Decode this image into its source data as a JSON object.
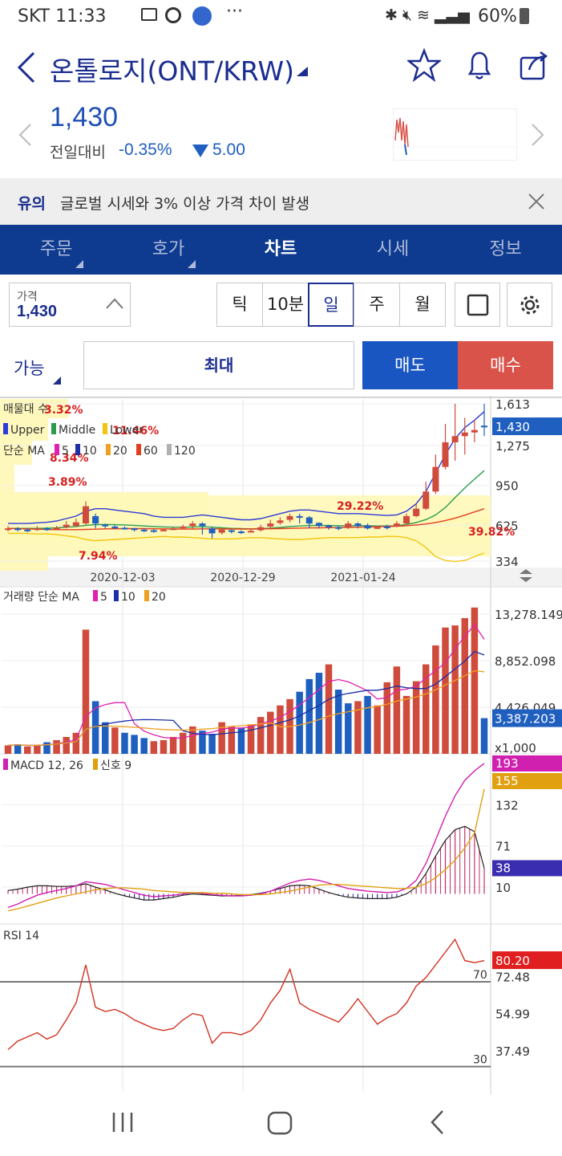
{
  "status": {
    "carrier_time": "SKT 11:33",
    "battery": "60%"
  },
  "header": {
    "title": "온톨로지(ONT/KRW)"
  },
  "quote": {
    "price": "1,430",
    "compare_label": "전일대비",
    "change_pct": "-0.35%",
    "change_abs": "5.00"
  },
  "notice": {
    "label": "유의",
    "text": "글로벌 시세와 3% 이상 가격 차이 발생"
  },
  "tabs": [
    {
      "label": "주문"
    },
    {
      "label": "호가"
    },
    {
      "label": "차트"
    },
    {
      "label": "시세"
    },
    {
      "label": "정보"
    }
  ],
  "controls": {
    "price_label": "가격",
    "price_value": "1,430",
    "intervals": [
      {
        "label": "틱"
      },
      {
        "label": "10분"
      },
      {
        "label": "일"
      },
      {
        "label": "주"
      },
      {
        "label": "월"
      }
    ]
  },
  "order": {
    "avail_label": "가능",
    "max_label": "최대",
    "sell_label": "매도",
    "buy_label": "매수"
  },
  "colors": {
    "brand": "#0e3b8f",
    "sell": "#1a56c2",
    "buy": "#d9534a",
    "up": "#cf4b3c",
    "down": "#1f5fbf"
  },
  "chart_data": [
    {
      "type": "candlestick",
      "legend": {
        "volume_profile": "매물대 수",
        "bollinger": [
          "Upper",
          "Middle",
          "Lower"
        ],
        "ma_label": "단순 MA",
        "ma_periods": [
          "5",
          "10",
          "20",
          "60",
          "120"
        ]
      },
      "price_ticks": [
        "1,613",
        "1,275",
        "950",
        "625",
        "334"
      ],
      "current_price": "1,430",
      "dates": [
        "2020-12-03",
        "2020-12-29",
        "2021-01-24"
      ],
      "profile_labels": [
        "3.32%",
        "11.46%",
        "3.89%",
        "7.94%",
        "29.22%",
        "39.82%"
      ],
      "profile_hidden": "8.34%",
      "close": [
        600,
        590,
        585,
        600,
        595,
        605,
        630,
        650,
        780,
        640,
        620,
        610,
        600,
        590,
        585,
        580,
        590,
        600,
        615,
        640,
        620,
        560,
        590,
        575,
        570,
        580,
        610,
        640,
        665,
        700,
        690,
        640,
        620,
        610,
        600,
        640,
        620,
        600,
        610,
        605,
        640,
        700,
        760,
        900,
        1100,
        1300,
        1350,
        1380,
        1400,
        1430
      ],
      "open": [
        590,
        600,
        590,
        590,
        600,
        600,
        610,
        620,
        640,
        700,
        630,
        615,
        605,
        600,
        590,
        585,
        585,
        595,
        605,
        620,
        640,
        600,
        565,
        585,
        575,
        575,
        585,
        615,
        645,
        670,
        700,
        690,
        645,
        625,
        610,
        605,
        640,
        625,
        605,
        615,
        615,
        640,
        700,
        760,
        900,
        1100,
        1300,
        1350,
        1380,
        1435
      ],
      "high": [
        620,
        610,
        600,
        620,
        610,
        620,
        660,
        680,
        820,
        720,
        640,
        625,
        615,
        605,
        600,
        595,
        600,
        615,
        630,
        660,
        650,
        615,
        600,
        590,
        585,
        600,
        630,
        670,
        690,
        720,
        720,
        700,
        650,
        630,
        620,
        660,
        650,
        640,
        620,
        630,
        660,
        720,
        800,
        980,
        1200,
        1450,
        1613,
        1500,
        1480,
        1613
      ],
      "low": [
        575,
        575,
        570,
        580,
        580,
        585,
        600,
        610,
        630,
        600,
        600,
        595,
        590,
        575,
        570,
        565,
        575,
        585,
        595,
        600,
        550,
        520,
        550,
        560,
        555,
        565,
        575,
        600,
        630,
        650,
        640,
        600,
        600,
        590,
        585,
        595,
        600,
        590,
        595,
        590,
        610,
        630,
        690,
        750,
        880,
        1080,
        1150,
        1200,
        1300,
        1350
      ],
      "ma_upper": [
        640,
        640,
        640,
        645,
        650,
        660,
        680,
        700,
        740,
        760,
        760,
        750,
        740,
        730,
        720,
        700,
        690,
        690,
        690,
        700,
        710,
        700,
        690,
        680,
        670,
        670,
        680,
        700,
        720,
        740,
        750,
        750,
        740,
        730,
        720,
        720,
        720,
        715,
        710,
        705,
        710,
        740,
        800,
        900,
        1050,
        1200,
        1330,
        1420,
        1480,
        1550
      ],
      "ma_middle": [
        600,
        600,
        600,
        600,
        602,
        605,
        610,
        615,
        625,
        630,
        632,
        630,
        628,
        625,
        620,
        615,
        612,
        610,
        610,
        612,
        614,
        610,
        605,
        600,
        598,
        596,
        598,
        602,
        608,
        615,
        620,
        624,
        625,
        624,
        622,
        622,
        623,
        622,
        620,
        620,
        622,
        632,
        648,
        672,
        710,
        770,
        850,
        930,
        1000,
        1070
      ],
      "ma_lower": [
        560,
        560,
        560,
        555,
        555,
        550,
        540,
        530,
        510,
        500,
        505,
        510,
        515,
        520,
        525,
        530,
        535,
        530,
        530,
        525,
        520,
        515,
        515,
        515,
        520,
        525,
        525,
        520,
        515,
        510,
        510,
        515,
        520,
        525,
        525,
        525,
        525,
        530,
        530,
        535,
        535,
        525,
        500,
        445,
        370,
        340,
        330,
        340,
        370,
        400
      ],
      "ma60": [
        600,
        598,
        596,
        594,
        592,
        590,
        590,
        590,
        592,
        594,
        596,
        597,
        598,
        598,
        598,
        597,
        596,
        595,
        595,
        595,
        596,
        596,
        596,
        595,
        595,
        595,
        596,
        597,
        598,
        600,
        602,
        604,
        605,
        606,
        607,
        608,
        610,
        612,
        614,
        616,
        618,
        622,
        628,
        636,
        648,
        664,
        684,
        708,
        734,
        760
      ],
      "price_axis": [
        334,
        1613
      ]
    },
    {
      "type": "bar",
      "legend": {
        "label": "거래량 단순 MA",
        "periods": [
          "5",
          "10",
          "20"
        ]
      },
      "ticks": [
        "13,278.149",
        "8,852.098",
        "4,426.049"
      ],
      "current": "3,387.203",
      "unit": "x1,000",
      "values": [
        800,
        900,
        700,
        800,
        1100,
        1300,
        1600,
        2000,
        11800,
        5000,
        3000,
        2500,
        2000,
        1800,
        1500,
        1200,
        1300,
        1600,
        2000,
        2600,
        2200,
        1900,
        3000,
        2600,
        2500,
        2800,
        3500,
        4000,
        4600,
        5200,
        5900,
        7100,
        7700,
        8500,
        6100,
        4800,
        5000,
        5500,
        4600,
        6800,
        8300,
        5500,
        6900,
        8500,
        10300,
        12000,
        12200,
        12900,
        13900,
        3387
      ],
      "up": [
        1,
        0,
        1,
        1,
        0,
        1,
        1,
        1,
        1,
        0,
        0,
        1,
        0,
        0,
        0,
        1,
        1,
        1,
        1,
        1,
        0,
        0,
        1,
        1,
        0,
        1,
        1,
        1,
        1,
        1,
        0,
        0,
        0,
        1,
        0,
        0,
        1,
        0,
        1,
        1,
        1,
        1,
        1,
        1,
        1,
        1,
        1,
        1,
        1,
        0
      ]
    },
    {
      "type": "line",
      "legend": {
        "macd": "MACD 12, 26",
        "signal": "신호 9"
      },
      "ticks": [
        "132",
        "71",
        "10"
      ],
      "current_macd": "193",
      "current_signal": "155",
      "current_hist": "38",
      "macd": [
        -20,
        -15,
        -8,
        -2,
        2,
        5,
        8,
        12,
        18,
        16,
        14,
        10,
        6,
        2,
        -2,
        -4,
        -3,
        -2,
        0,
        2,
        1,
        -1,
        -2,
        -3,
        -3,
        -2,
        0,
        4,
        10,
        16,
        20,
        22,
        20,
        16,
        12,
        8,
        6,
        4,
        3,
        2,
        3,
        8,
        20,
        45,
        80,
        115,
        145,
        168,
        182,
        193
      ],
      "signal": [
        -25,
        -22,
        -18,
        -14,
        -10,
        -6,
        -3,
        0,
        3,
        6,
        8,
        9,
        9,
        8,
        7,
        5,
        4,
        3,
        2,
        2,
        2,
        1,
        1,
        0,
        -1,
        -1,
        -1,
        0,
        2,
        4,
        7,
        10,
        13,
        14,
        14,
        13,
        12,
        11,
        10,
        9,
        8,
        8,
        10,
        15,
        24,
        36,
        50,
        68,
        90,
        155
      ]
    },
    {
      "type": "line",
      "legend": {
        "label": "RSI 14"
      },
      "ticks": [
        "72.48",
        "54.99",
        "37.49"
      ],
      "ref_high": "70",
      "ref_low": "30",
      "current": "80.20",
      "values": [
        38,
        42,
        44,
        46,
        43,
        45,
        52,
        60,
        78,
        58,
        56,
        57,
        55,
        52,
        50,
        48,
        47,
        48,
        52,
        55,
        54,
        41,
        46,
        46,
        45,
        47,
        52,
        60,
        66,
        76,
        60,
        57,
        55,
        53,
        51,
        56,
        62,
        56,
        50,
        53,
        55,
        60,
        68,
        72,
        78,
        84,
        90,
        80,
        79,
        80
      ]
    }
  ]
}
